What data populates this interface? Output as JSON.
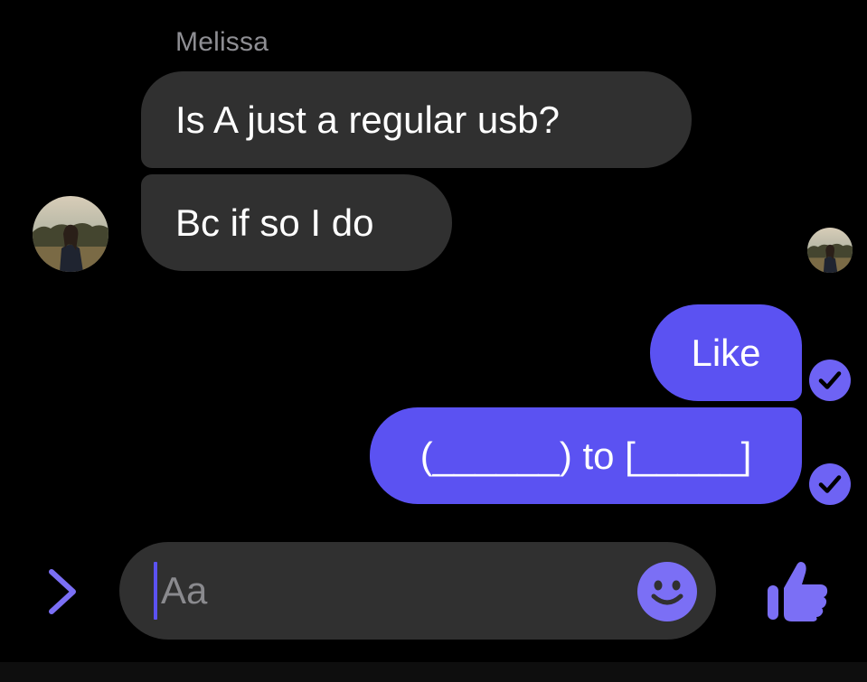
{
  "conversation": {
    "sender_name": "Melissa",
    "messages": [
      {
        "direction": "incoming",
        "text": "Is A just a regular usb?"
      },
      {
        "direction": "incoming",
        "text": "Bc if so I do"
      },
      {
        "direction": "outgoing",
        "text": "Like",
        "status": "delivered"
      },
      {
        "direction": "outgoing",
        "text": "(______) to [_____]",
        "status": "delivered"
      }
    ]
  },
  "composer": {
    "placeholder": "Aa",
    "expand_icon": "chevron-right-icon",
    "emoji_icon": "smiley-icon",
    "send_icon": "thumbs-up-icon"
  },
  "colors": {
    "background": "#000000",
    "incoming_bubble": "#303030",
    "outgoing_bubble": "#5b52f2",
    "accent": "#7b6ff5",
    "secondary_text": "#8e8e93"
  }
}
